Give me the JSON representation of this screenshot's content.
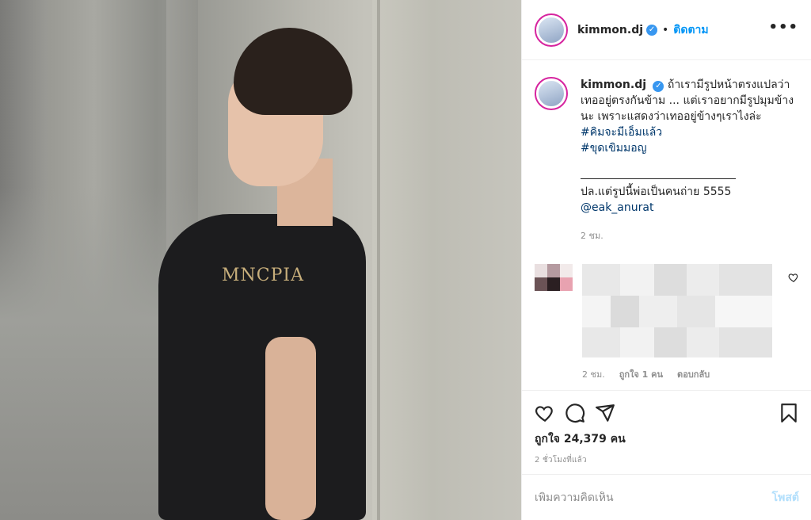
{
  "post": {
    "username": "kimmon.dj",
    "verified_icon": "verified-badge-icon",
    "follow_dot": "•",
    "follow_label": "ติดตาม",
    "more_label": "•••",
    "shirt_print": "MNCPIA"
  },
  "caption": {
    "username": "kimmon.dj",
    "text": " ถ้าเรามีรูปหน้าตรงแปลว่าเทออยู่ตรงกันข้าม ... แต่เราอยากมีรูปมุมข้างนะ เพราะแสดงว่าเทออยู่ข้างๆเราไงล่ะ",
    "hashtag_1": "#คิมจะมีเอ็มแล้ว",
    "hashtag_2": "#ขุดเขิมมอญ",
    "ps_text": "ปล.แต่รูปนี้พ่อเป็นคนถ่าย 5555",
    "mention": "@eak_anurat",
    "time": "2 ชม."
  },
  "comment": {
    "time": "2 ชม.",
    "likes": "ถูกใจ 1 คน",
    "reply_label": "ตอบกลับ"
  },
  "actions": {
    "likes_text": "ถูกใจ 24,379 คน",
    "time_ago": "2 ชั่วโมงที่แล้ว"
  },
  "add_comment": {
    "placeholder": "เพิ่มความคิดเห็น",
    "post_label": "โพสต์"
  },
  "colors": {
    "accent": "#0095f6",
    "link": "#00376b",
    "muted": "#8e8e8e",
    "post_disabled": "#b2dffc"
  }
}
